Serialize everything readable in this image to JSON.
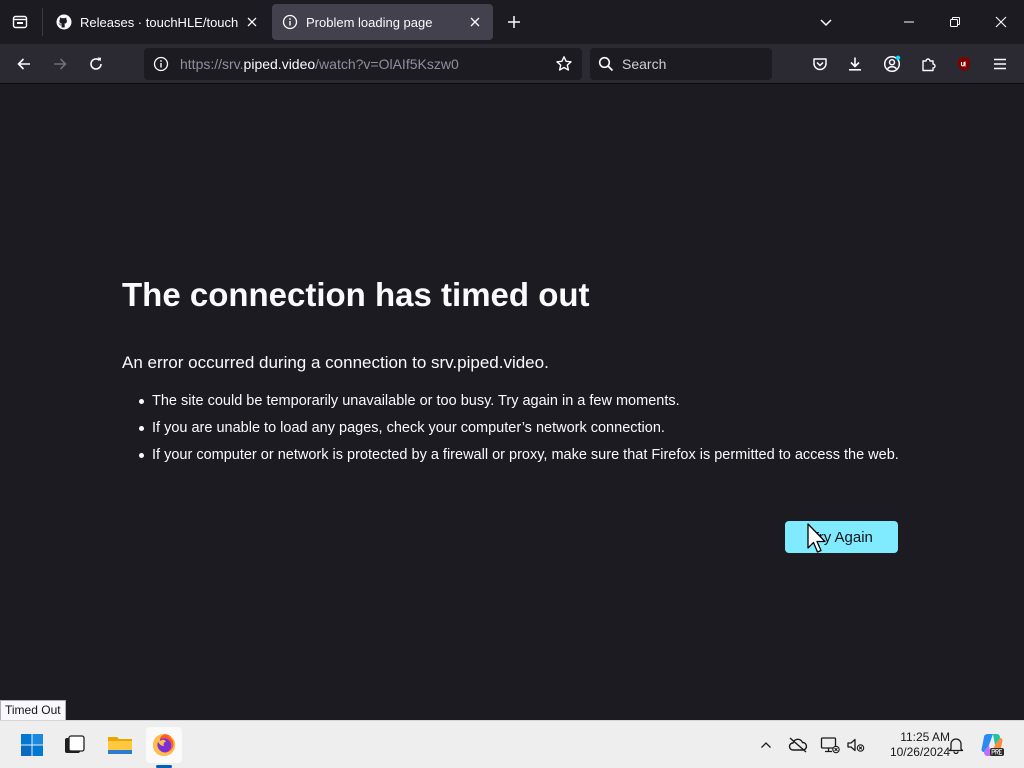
{
  "browser": {
    "tabs": [
      {
        "title": "Releases · touchHLE/touchHLE",
        "icon": "github-icon",
        "active": false
      },
      {
        "title": "Problem loading page",
        "icon": "info-icon",
        "active": true
      }
    ],
    "url": {
      "prefix": "https://srv.",
      "host": "piped.video",
      "path": "/watch?v=OlAIf5Kszw0"
    },
    "search_placeholder": "Search",
    "accent_color": "#80ebff"
  },
  "error_page": {
    "title": "The connection has timed out",
    "intro": "An error occurred during a connection to srv.piped.video.",
    "bullets": [
      "The site could be temporarily unavailable or too busy. Try again in a few moments.",
      "If you are unable to load any pages, check your computer’s network connection.",
      "If your computer or network is protected by a firewall or proxy, make sure that Firefox is permitted to access the web."
    ],
    "button": "Try Again"
  },
  "status_text": "Timed Out",
  "taskbar": {
    "apps": [
      "windows-start-icon",
      "task-view-icon",
      "file-explorer-icon",
      "firefox-icon"
    ],
    "time": "11:25 AM",
    "date": "10/26/2024"
  }
}
